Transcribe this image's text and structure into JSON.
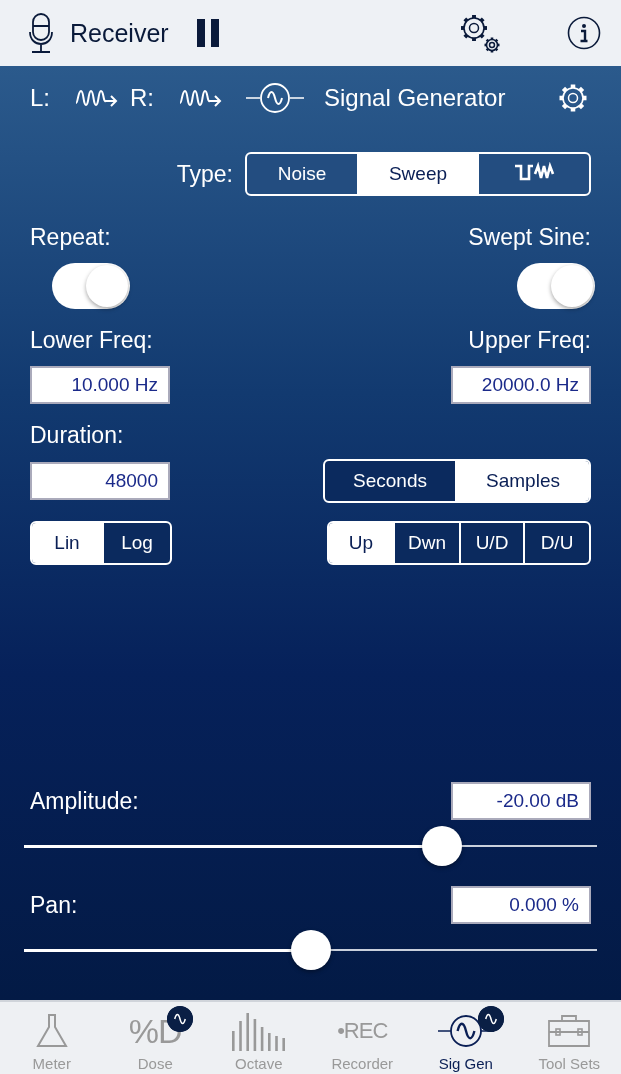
{
  "top_bar": {
    "source": "Receiver",
    "paused": true
  },
  "header": {
    "left_label": "L:",
    "right_label": "R:",
    "title": "Signal Generator"
  },
  "type": {
    "label": "Type:",
    "options": [
      {
        "kind": "text",
        "label": "Noise",
        "selected": false
      },
      {
        "kind": "text",
        "label": "Sweep",
        "selected": true
      },
      {
        "kind": "icon",
        "selected": false
      }
    ]
  },
  "repeat": {
    "label": "Repeat:",
    "on": true
  },
  "swept_sine": {
    "label": "Swept Sine:",
    "on": true
  },
  "lower_freq": {
    "label": "Lower Freq:",
    "value": "10.000 Hz"
  },
  "upper_freq": {
    "label": "Upper Freq:",
    "value": "20000.0 Hz"
  },
  "duration": {
    "label": "Duration:",
    "value": "48000"
  },
  "duration_unit": [
    {
      "label": "Seconds",
      "selected": false
    },
    {
      "label": "Samples",
      "selected": true
    }
  ],
  "scale": [
    {
      "label": "Lin",
      "selected": true
    },
    {
      "label": "Log",
      "selected": false
    }
  ],
  "direction": [
    {
      "label": "Up",
      "selected": true
    },
    {
      "label": "Dwn",
      "selected": false
    },
    {
      "label": "U/D",
      "selected": false
    },
    {
      "label": "D/U",
      "selected": false
    }
  ],
  "amplitude": {
    "label": "Amplitude:",
    "value": "-20.00 dB",
    "level": 0.73
  },
  "pan": {
    "label": "Pan:",
    "value": "0.000 %",
    "level": 0.5
  },
  "tabs": [
    {
      "kind": "flask",
      "label": "Meter",
      "selected": false,
      "badge": false
    },
    {
      "kind": "glyph",
      "glyph": "%D",
      "label": "Dose",
      "selected": false,
      "badge": true
    },
    {
      "kind": "bars",
      "label": "Octave",
      "selected": false,
      "badge": false
    },
    {
      "kind": "glyph",
      "glyph": "•REC",
      "label": "Recorder",
      "selected": false,
      "badge": false
    },
    {
      "kind": "siggen",
      "label": "Sig Gen",
      "selected": true,
      "badge": true
    },
    {
      "kind": "toolbox",
      "label": "Tool Sets",
      "selected": false,
      "badge": false
    }
  ]
}
